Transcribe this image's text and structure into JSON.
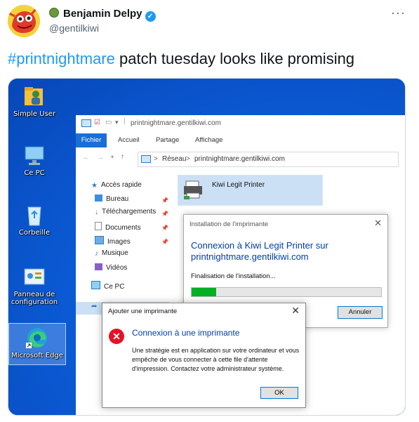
{
  "tweet": {
    "author_name": "Benjamin Delpy",
    "handle": "@gentilkiwi",
    "more_glyph": "···",
    "hashtag": "#printnightmare",
    "text": " patch tuesday looks like promising"
  },
  "desktop": {
    "icons": [
      {
        "label": "Simple User",
        "icon": "user-folder-icon"
      },
      {
        "label": "Ce PC",
        "icon": "computer-icon"
      },
      {
        "label": "Corbeille",
        "icon": "recycle-bin-icon"
      },
      {
        "label": "Panneau de configuration",
        "icon": "control-panel-icon"
      },
      {
        "label": "Microsoft Edge",
        "icon": "edge-icon"
      }
    ]
  },
  "explorer": {
    "window_title": "printnightmare.gentilkiwi.com",
    "ribbon_tabs": [
      "Fichier",
      "Accueil",
      "Partage",
      "Affichage"
    ],
    "address": {
      "root": "Réseau",
      "separator": ">",
      "location": "printnightmare.gentilkiwi.com"
    },
    "nav": [
      {
        "label": "Accès rapide",
        "icon": "star-icon"
      },
      {
        "label": "Bureau",
        "icon": "desktop-icon"
      },
      {
        "label": "Téléchargements",
        "icon": "download-icon"
      },
      {
        "label": "Documents",
        "icon": "documents-icon"
      },
      {
        "label": "Images",
        "icon": "images-icon"
      },
      {
        "label": "Musique",
        "icon": "music-icon"
      },
      {
        "label": "Vidéos",
        "icon": "videos-icon"
      },
      {
        "label": "Ce PC",
        "icon": "computer-icon"
      }
    ],
    "printer_item": "Kiwi Legit Printer"
  },
  "install_dialog": {
    "title": "Installation de l'imprimante",
    "heading": "Connexion à Kiwi Legit Printer sur printnightmare.gentilkiwi.com",
    "status": "Finalisation de l'installation...",
    "progress": 0.13,
    "cancel_label": "Annuler"
  },
  "error_dialog": {
    "title": "Ajouter une imprimante",
    "heading": "Connexion à une imprimante",
    "message": "Une stratégie est en application sur votre ordinateur et vous empêche de vous connecter à cette file d'attente d'impression. Contactez votre administrateur système.",
    "ok_label": "OK"
  },
  "colors": {
    "tweet_link": "#1d9bf0",
    "windows_accent": "#0078d7",
    "error": "#e81123",
    "progress": "#06b025"
  }
}
